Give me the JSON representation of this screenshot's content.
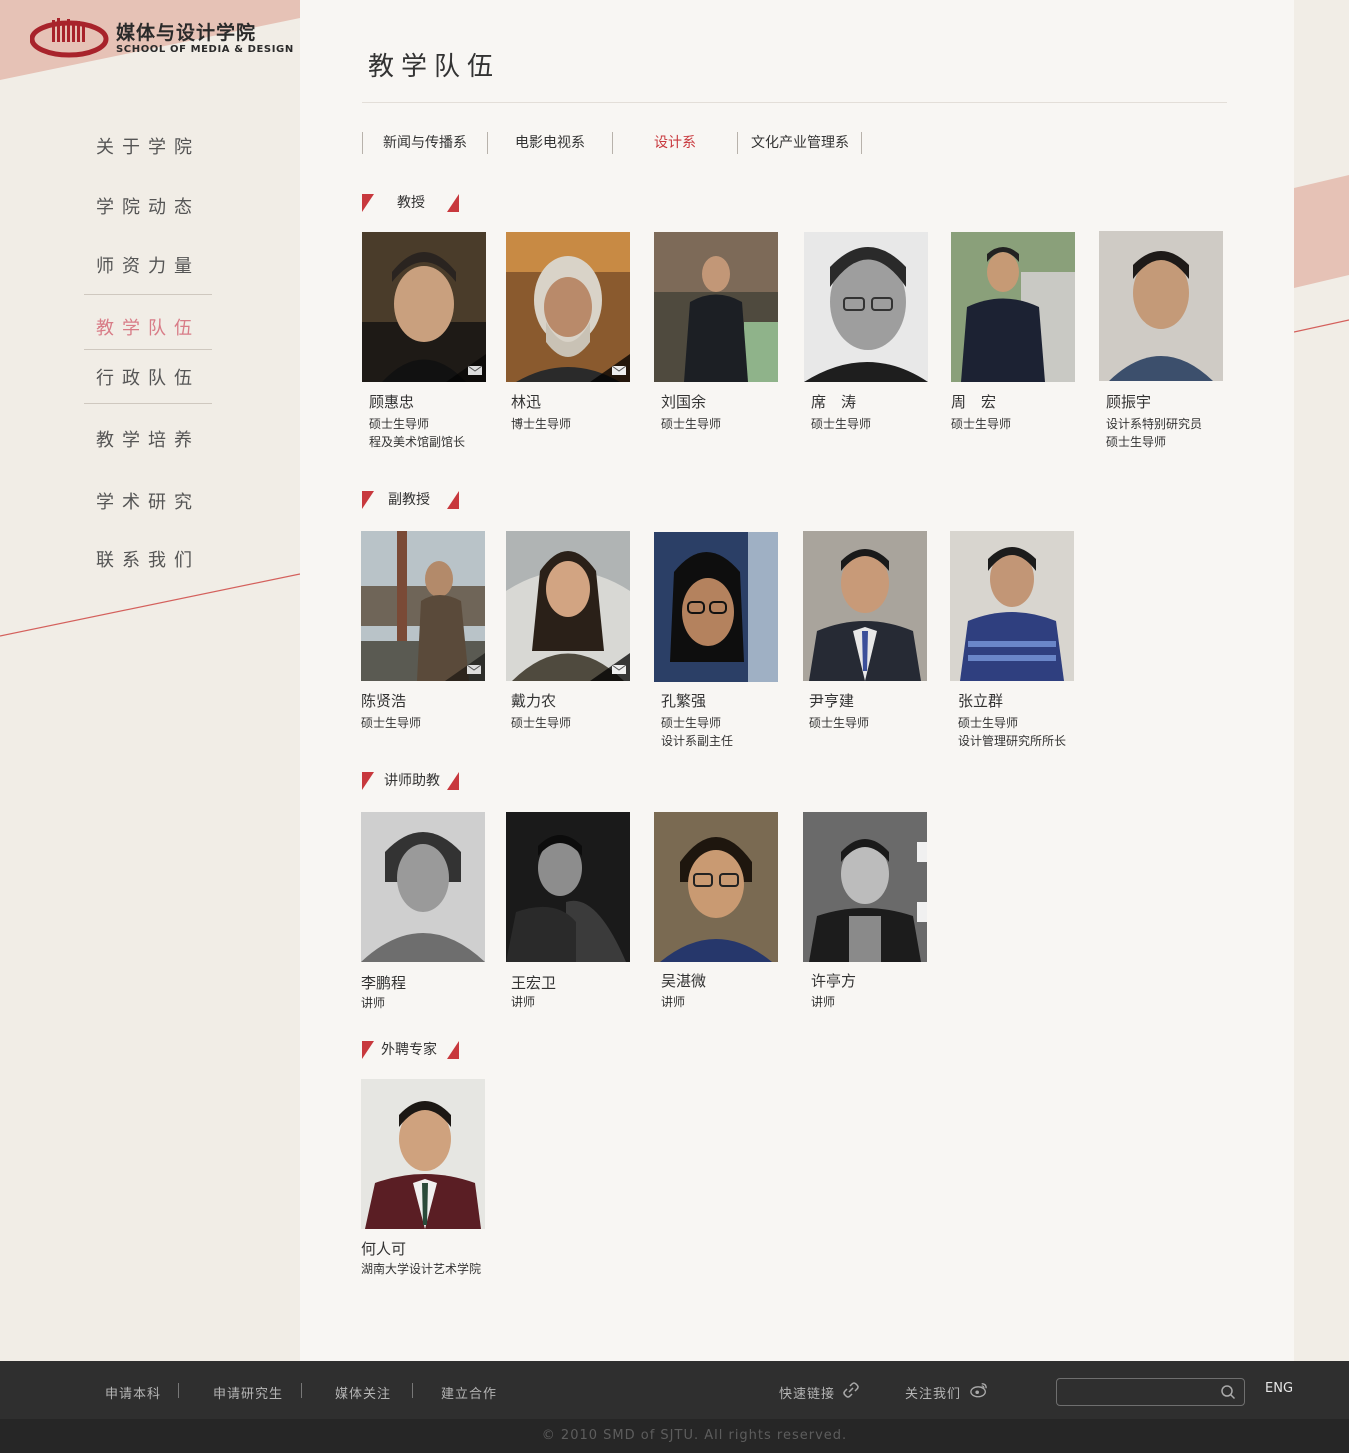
{
  "colors": {
    "accent": "#c8383d",
    "sidebar_active": "#d87c87",
    "footer_bg": "#2f2f2f",
    "main_bg": "#f8f6f3"
  },
  "logo": {
    "name_cn": "媒体与设计学院",
    "name_en": "SCHOOL OF MEDIA & DESIGN"
  },
  "sidebar": {
    "items": [
      {
        "label": "关于学院"
      },
      {
        "label": "学院动态"
      },
      {
        "label": "师资力量"
      },
      {
        "label": "教学队伍",
        "active": true
      },
      {
        "label": "行政队伍"
      },
      {
        "label": "教学培养"
      },
      {
        "label": "学术研究"
      },
      {
        "label": "联系我们"
      }
    ]
  },
  "page": {
    "title": "教学队伍"
  },
  "tabs": [
    {
      "label": "新闻与传播系"
    },
    {
      "label": "电影电视系"
    },
    {
      "label": "设计系",
      "active": true
    },
    {
      "label": "文化产业管理系"
    }
  ],
  "sections": [
    {
      "title": "教授",
      "people": [
        {
          "name": "顾惠忠",
          "lines": [
            "硕士生导师",
            "程及美术馆副馆长"
          ],
          "mail_icon": true
        },
        {
          "name": "林迅",
          "lines": [
            "博士生导师"
          ],
          "mail_icon": true
        },
        {
          "name": "刘国余",
          "lines": [
            "硕士生导师"
          ]
        },
        {
          "name": "席　涛",
          "lines": [
            "硕士生导师"
          ]
        },
        {
          "name": "周　宏",
          "lines": [
            "硕士生导师"
          ]
        },
        {
          "name": "顾振宇",
          "lines": [
            "设计系特别研究员",
            "硕士生导师"
          ]
        }
      ]
    },
    {
      "title": "副教授",
      "people": [
        {
          "name": "陈贤浩",
          "lines": [
            "硕士生导师"
          ],
          "mail_icon": true
        },
        {
          "name": "戴力农",
          "lines": [
            "硕士生导师"
          ],
          "mail_icon": true
        },
        {
          "name": "孔繁强",
          "lines": [
            "硕士生导师",
            "设计系副主任"
          ]
        },
        {
          "name": "尹亨建",
          "lines": [
            "硕士生导师"
          ]
        },
        {
          "name": "张立群",
          "lines": [
            "硕士生导师",
            "设计管理研究所所长"
          ]
        }
      ]
    },
    {
      "title": "讲师助教",
      "people": [
        {
          "name": "李鹏程",
          "lines": [
            "讲师"
          ]
        },
        {
          "name": "王宏卫",
          "lines": [
            "讲师"
          ]
        },
        {
          "name": "吴湛微",
          "lines": [
            "讲师"
          ]
        },
        {
          "name": "许亭方",
          "lines": [
            "讲师"
          ]
        }
      ]
    },
    {
      "title": "外聘专家",
      "people": [
        {
          "name": "何人可",
          "lines": [
            "湖南大学设计艺术学院"
          ]
        }
      ]
    }
  ],
  "footer": {
    "links": [
      "申请本科",
      "申请研究生",
      "媒体关注",
      "建立合作"
    ],
    "quick_links": "快速链接",
    "quick_links_icon": "link-icon",
    "follow": "关注我们",
    "follow_icon": "weibo-icon",
    "search": {
      "placeholder": "",
      "icon": "search-icon"
    },
    "lang": "ENG",
    "copyright": "© 2010 SMD of SJTU. All rights reserved."
  }
}
